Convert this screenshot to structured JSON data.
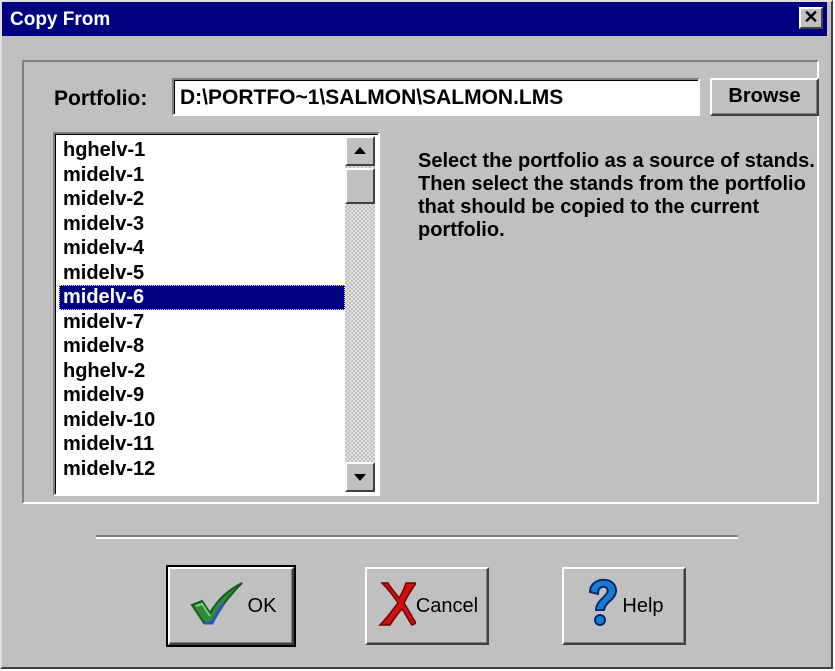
{
  "window": {
    "title": "Copy From",
    "close_glyph": "✕"
  },
  "portfolio": {
    "label": "Portfolio:",
    "path": "D:\\PORTFO~1\\SALMON\\SALMON.LMS",
    "browse_label": "Browse"
  },
  "stands": {
    "items": [
      "hghelv-1",
      "midelv-1",
      "midelv-2",
      "midelv-3",
      "midelv-4",
      "midelv-5",
      "midelv-6",
      "midelv-7",
      "midelv-8",
      "hghelv-2",
      "midelv-9",
      "midelv-10",
      "midelv-11",
      "midelv-12"
    ],
    "selected": "midelv-6"
  },
  "instructions": "Select the portfolio as a source of stands.  Then select the stands from the portfolio that should be copied to the current portfolio.",
  "buttons": {
    "ok": {
      "label": "OK",
      "icon": "checkmark-icon"
    },
    "cancel": {
      "label": "Cancel",
      "icon": "red-x-icon"
    },
    "help": {
      "label": "Help",
      "icon": "question-mark-icon"
    }
  },
  "colors": {
    "titlebar": "#000080",
    "selection": "#000080",
    "face": "#c0c0c0"
  }
}
